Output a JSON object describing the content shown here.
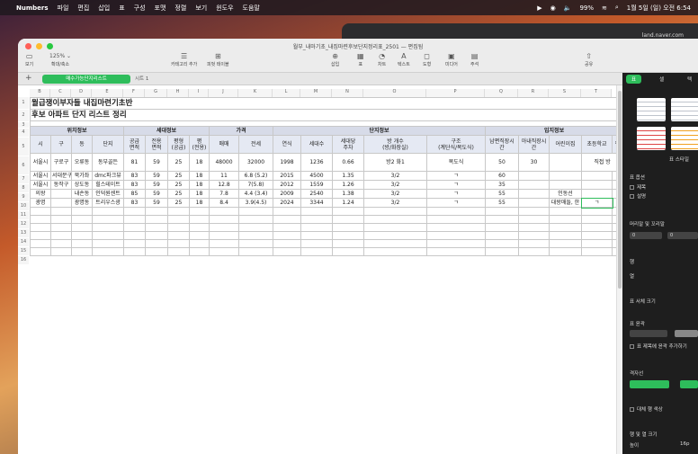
{
  "menubar": {
    "apple": "",
    "app_name": "Numbers",
    "items": [
      "파일",
      "편집",
      "삽입",
      "표",
      "구성",
      "포맷",
      "정렬",
      "보기",
      "윈도우",
      "도움말"
    ],
    "battery": "99%",
    "datetime": "1월 5일 (일) 오전 6:54"
  },
  "bg_window": {
    "url": "land.naver.com"
  },
  "window": {
    "title": "월부_내마기초_내집마련후보단지정리표_2501 — 편집됨",
    "toolbar_left": [
      {
        "label": "보기",
        "icon": "sidebar-icon"
      },
      {
        "label": "확대/축소",
        "value": "125% ⌄"
      }
    ],
    "toolbar_mid": [
      {
        "label": "카테고리 추가",
        "icon": "list-icon"
      },
      {
        "label": "피벗 테이블",
        "icon": "pivot-icon"
      }
    ],
    "toolbar_insert": [
      {
        "label": "삽입",
        "icon": "insert-icon"
      },
      {
        "label": "표",
        "icon": "table-icon"
      },
      {
        "label": "차트",
        "icon": "chart-icon"
      },
      {
        "label": "텍스트",
        "icon": "text-icon"
      },
      {
        "label": "도형",
        "icon": "shape-icon"
      },
      {
        "label": "미디어",
        "icon": "media-icon"
      },
      {
        "label": "주석",
        "icon": "comment-icon"
      }
    ],
    "share_label": "공유"
  },
  "sheets": {
    "add": "+",
    "tabs": [
      "매수가능단지리스트",
      "시트 1"
    ]
  },
  "columns": [
    "B",
    "C",
    "D",
    "E",
    "F",
    "G",
    "H",
    "I",
    "J",
    "K",
    "L",
    "M",
    "N",
    "O",
    "P",
    "Q",
    "R",
    "S",
    "T"
  ],
  "rows": [
    "1",
    "2",
    "3",
    "4",
    "5",
    "6",
    "7",
    "8",
    "9",
    "10",
    "11",
    "12",
    "13",
    "14",
    "15",
    "16"
  ],
  "table": {
    "title1": "월급쟁이부자들 내집마련기초반",
    "title2": "후보 아파트 단지 리스트 정리",
    "groups": [
      "위치정보",
      "세대정보",
      "가격",
      "단지정보",
      "입지정보"
    ],
    "headers": [
      "시",
      "구",
      "동",
      "단지",
      "공급\n면적",
      "전용\n면적",
      "평형\n(공급)",
      "평\n(전용)",
      "매매",
      "전세",
      "연식",
      "세대수",
      "세대당\n주차",
      "방 개수\n(방/화장실)",
      "구조\n(계단식/복도식)",
      "남편직장시\n간",
      "아내직장시\n간",
      "어린이집",
      "초등학교",
      "편"
    ],
    "row6": [
      "서울시",
      "구로구",
      "오류동",
      "동부골든",
      "81",
      "59",
      "25",
      "18",
      "48000",
      "32000",
      "1998",
      "1236",
      "0.66",
      "방2 화1",
      "복도식",
      "50",
      "30",
      "",
      "직접 방",
      ""
    ],
    "data_rows": [
      [
        "서울시",
        "서대문구",
        "북가좌",
        "dmc파크뷰",
        "83",
        "59",
        "25",
        "18",
        "11",
        "6.8 (5.2)",
        "2015",
        "4500",
        "1.35",
        "3/2",
        "ㄱ",
        "60",
        "",
        "",
        ""
      ],
      [
        "서울시",
        "동작구",
        "상도동",
        "힐스테이트",
        "83",
        "59",
        "25",
        "18",
        "12.8",
        "7(5.8)",
        "2012",
        "1559",
        "1.26",
        "3/2",
        "ㄱ",
        "35",
        "",
        "",
        ""
      ],
      [
        "의왕",
        "",
        "내손동",
        "인덕원센트",
        "85",
        "59",
        "25",
        "18",
        "7.8",
        "4.4 (3.4)",
        "2009",
        "2540",
        "1.38",
        "3/2",
        "ㄱ",
        "55",
        "",
        "인동선",
        ""
      ],
      [
        "광명",
        "",
        "광명동",
        "트리우스광",
        "83",
        "59",
        "25",
        "18",
        "8.4",
        "3.9(4.5)",
        "2024",
        "3344",
        "1.24",
        "3/2",
        "ㄱ",
        "55",
        "",
        "대왕매들, 한",
        "ㄱ"
      ]
    ]
  },
  "panel": {
    "tabs": [
      "표",
      "셀",
      "텍"
    ],
    "style_label": "표 스타일",
    "options_label": "표 옵션",
    "opt_title": "제목",
    "opt_caption": "설명",
    "header_footer_label": "머리말 및 꼬리말",
    "hf_value1": "0",
    "hf_value2": "0",
    "row_label": "행",
    "col_label": "열",
    "font_size_label": "표 서체 크기",
    "outline_label": "표 윤곽",
    "outline_check": "표 제목에 윤곽 추가하기",
    "grid_label": "격자선",
    "alt_row_label": "대체 행 색상",
    "rowcol_size_label": "행 및 열 크기",
    "height_label": "높이",
    "height_value": "16p"
  }
}
